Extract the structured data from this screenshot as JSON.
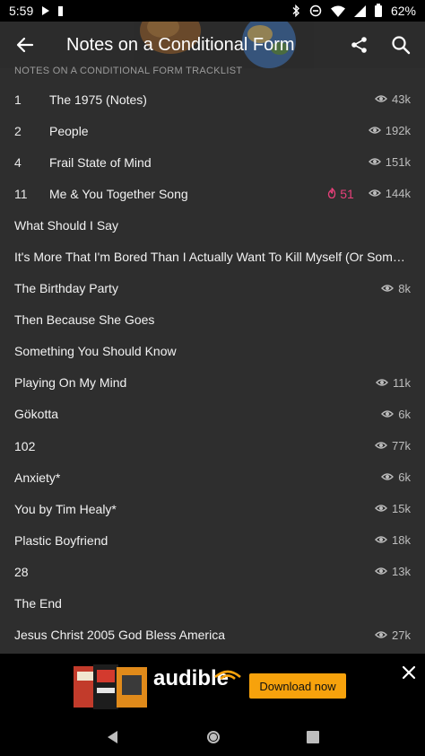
{
  "status_bar": {
    "time": "5:59",
    "battery": "62%"
  },
  "header": {
    "title": "Notes on a Conditional Form"
  },
  "section_header": "NOTES ON A CONDITIONAL FORM TRACKLIST",
  "colors": {
    "background": "#2e2e2e",
    "hot": "#e8407a",
    "button": "#f7a20c"
  },
  "tracks": [
    {
      "number": "1",
      "title": "The 1975 (Notes)",
      "hot": "",
      "views": "43k"
    },
    {
      "number": "2",
      "title": "People",
      "hot": "",
      "views": "192k"
    },
    {
      "number": "4",
      "title": "Frail State of Mind",
      "hot": "",
      "views": "151k"
    },
    {
      "number": "11",
      "title": "Me & You Together Song",
      "hot": "51",
      "views": "144k"
    },
    {
      "number": "",
      "title": "What Should I Say",
      "hot": "",
      "views": ""
    },
    {
      "number": "",
      "title": "It's More That I'm Bored Than I Actually Want To Kill Myself (Or Something Along Those Lines)",
      "hot": "",
      "views": ""
    },
    {
      "number": "",
      "title": "The Birthday Party",
      "hot": "",
      "views": "8k"
    },
    {
      "number": "",
      "title": "Then Because She Goes",
      "hot": "",
      "views": ""
    },
    {
      "number": "",
      "title": "Something You Should Know",
      "hot": "",
      "views": ""
    },
    {
      "number": "",
      "title": "Playing On My Mind",
      "hot": "",
      "views": "11k"
    },
    {
      "number": "",
      "title": "Gökotta",
      "hot": "",
      "views": "6k"
    },
    {
      "number": "",
      "title": "102",
      "hot": "",
      "views": "77k"
    },
    {
      "number": "",
      "title": "Anxiety*",
      "hot": "",
      "views": "6k"
    },
    {
      "number": "",
      "title": "You by Tim Healy*",
      "hot": "",
      "views": "15k"
    },
    {
      "number": "",
      "title": "Plastic Boyfriend",
      "hot": "",
      "views": "18k"
    },
    {
      "number": "",
      "title": "28",
      "hot": "",
      "views": "13k"
    },
    {
      "number": "",
      "title": "The End",
      "hot": "",
      "views": ""
    },
    {
      "number": "",
      "title": "Jesus Christ 2005 God Bless America",
      "hot": "",
      "views": "27k"
    }
  ],
  "ad": {
    "brand": "audible",
    "cta": "Download now"
  },
  "icons": {
    "back": "arrow-left-icon",
    "share": "share-icon",
    "search": "search-icon",
    "views": "eye-icon",
    "hot": "flame-icon",
    "close": "close-icon"
  }
}
